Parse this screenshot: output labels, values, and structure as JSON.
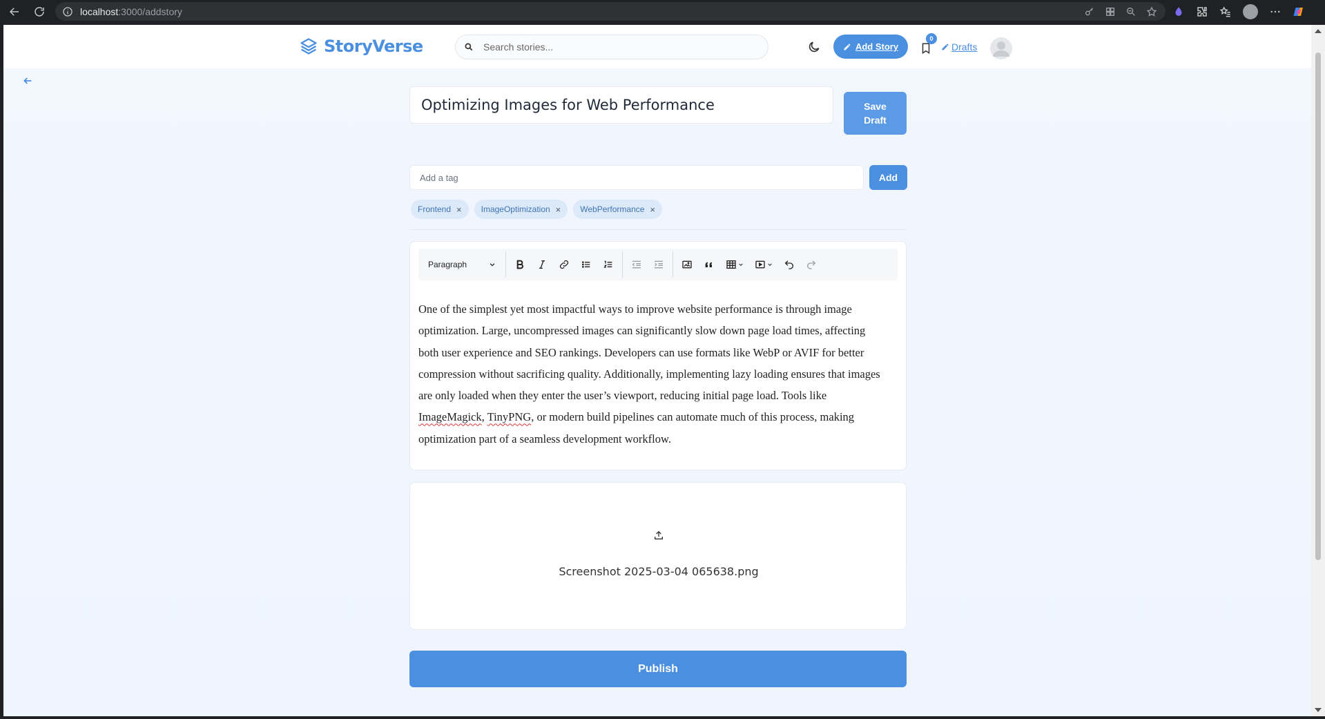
{
  "browser": {
    "url_host": "localhost",
    "url_path": ":3000/addstory"
  },
  "header": {
    "brand_name": "StoryVerse",
    "search_placeholder": "Search stories...",
    "add_story_label": "Add Story",
    "bookmark_count": "0",
    "drafts_label": "Drafts"
  },
  "editor": {
    "title": "Optimizing Images for Web Performance",
    "save_draft_label": "Save Draft",
    "tag_placeholder": "Add a tag",
    "tag_add_label": "Add",
    "tags": [
      "Frontend",
      "ImageOptimization",
      "WebPerformance"
    ],
    "tag_remove_symbol": "×",
    "block_type": "Paragraph",
    "body": {
      "part1": "One of the simplest yet most impactful ways to improve website performance is through image optimization. Large, uncompressed images can significantly slow down page load times, affecting both user experience and SEO rankings. Developers can use formats like WebP or AVIF for better compression without sacrificing quality. Additionally, implementing lazy loading ensures that images are only loaded when they enter the user’s viewport, reducing initial page load. Tools like ",
      "word1": "ImageMagick",
      "sep": ", ",
      "word2": "TinyPNG",
      "part2": ", or modern build pipelines can automate much of this process, making optimization part of a seamless development workflow."
    }
  },
  "upload": {
    "file_name": "Screenshot 2025-03-04 065638.png"
  },
  "publish_label": "Publish",
  "colors": {
    "accent": "#4a8fe0",
    "background": "#eef5ff",
    "tag_bg": "#dbe9f9"
  }
}
